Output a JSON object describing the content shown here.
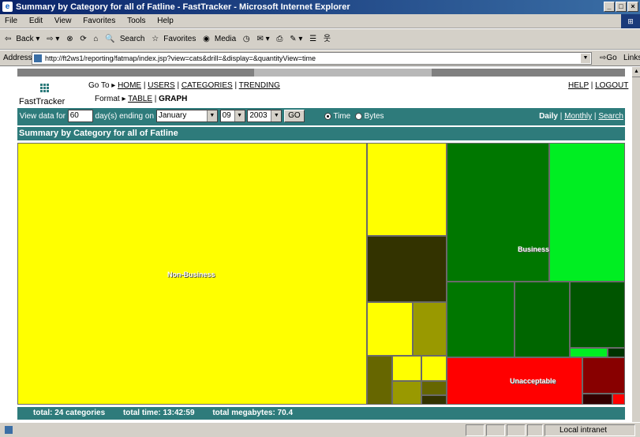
{
  "window": {
    "title": "Summary by Category for all of Fatline - FastTracker - Microsoft Internet Explorer"
  },
  "menu": [
    "File",
    "Edit",
    "View",
    "Favorites",
    "Tools",
    "Help"
  ],
  "toolbar": {
    "back": "Back",
    "search": "Search",
    "favorites": "Favorites",
    "media": "Media"
  },
  "address": {
    "label": "Address",
    "url": "http://ft2ws1/reporting/fatmap/index.jsp?view=cats&drill=&display=&quantityView=time",
    "go": "Go",
    "links": "Links"
  },
  "header": {
    "brand": "FastTracker",
    "goto_label": "Go To ▸",
    "nav": [
      "HOME",
      "USERS",
      "CATEGORIES",
      "TRENDING"
    ],
    "format_label": "Format ▸",
    "format_table": "TABLE",
    "format_graph": "GRAPH",
    "help": "HELP",
    "logout": "LOGOUT"
  },
  "controls": {
    "view_data_for": "View data for",
    "days_value": "60",
    "days_ending_on": "day(s) ending on",
    "month": "January",
    "day": "09",
    "year": "2003",
    "go": "GO",
    "radio_time": "Time",
    "radio_bytes": "Bytes",
    "daily": "Daily",
    "monthly": "Monthly",
    "search": "Search"
  },
  "summary_title": "Summary by Category for all of Fatline",
  "treemap": {
    "labels": {
      "non_business": "Non-Business",
      "business": "Business",
      "unacceptable": "Unacceptable"
    },
    "colors": {
      "yellow": "#ffff00",
      "dark_olive": "#333300",
      "olive": "#999900",
      "olive2": "#666600",
      "green_dark": "#007700",
      "green_bright": "#00ee22",
      "red": "#ff0000",
      "dark_red": "#880000"
    }
  },
  "footer": {
    "total_categories": "total: 24 categories",
    "total_time": "total time: 13:42:59",
    "total_megabytes": "total megabytes: 70.4"
  },
  "status": {
    "zone": "Local intranet"
  }
}
